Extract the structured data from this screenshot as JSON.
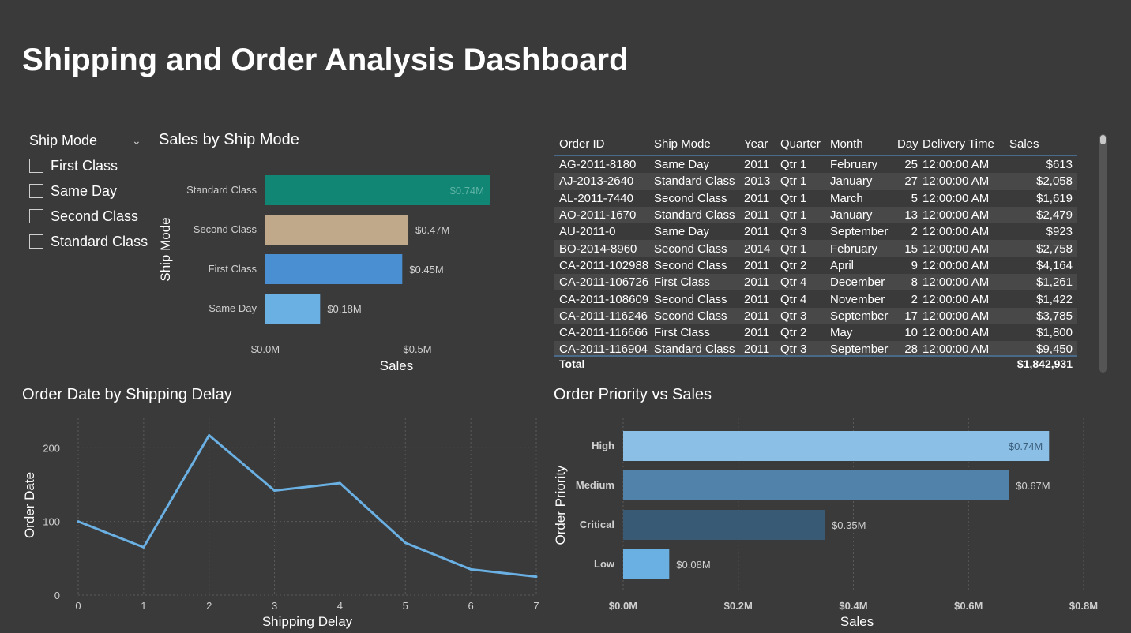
{
  "page": {
    "title": "Shipping and Order Analysis Dashboard"
  },
  "slicer": {
    "title": "Ship Mode",
    "items": [
      {
        "label": "First Class",
        "checked": false
      },
      {
        "label": "Same Day",
        "checked": false
      },
      {
        "label": "Second Class",
        "checked": false
      },
      {
        "label": "Standard Class",
        "checked": false
      }
    ]
  },
  "colors": {
    "background": "#3a3a3a",
    "line": "#6ab0e3",
    "text": "#ffffff"
  },
  "icons": {
    "slicer_dropdown": "chevron-down-icon"
  },
  "chart_data": [
    {
      "id": "sales_by_ship_mode",
      "type": "bar",
      "orientation": "horizontal",
      "title": "Sales by Ship Mode",
      "xlabel": "Sales",
      "ylabel": "Ship Mode",
      "categories": [
        "Standard Class",
        "Second Class",
        "First Class",
        "Same Day"
      ],
      "values": [
        0.74,
        0.47,
        0.45,
        0.18
      ],
      "data_labels": [
        "$0.74M",
        "$0.47M",
        "$0.45M",
        "$0.18M"
      ],
      "colors": [
        "#118675",
        "#c0a88a",
        "#4a8fd1",
        "#6ab0e3"
      ],
      "xlim": [
        0,
        0.74
      ],
      "xticks": [
        0,
        0.5
      ],
      "xtick_labels": [
        "$0.0M",
        "$0.5M"
      ],
      "grid": false
    },
    {
      "id": "order_date_by_shipping_delay",
      "type": "line",
      "title": "Order Date by Shipping Delay",
      "xlabel": "Shipping Delay",
      "ylabel": "Order Date",
      "x": [
        0,
        1,
        2,
        3,
        4,
        5,
        6,
        7
      ],
      "series": [
        {
          "values": [
            100,
            65,
            217,
            142,
            152,
            71,
            35,
            25
          ]
        }
      ],
      "xlim": [
        0,
        7
      ],
      "ylim": [
        0,
        240
      ],
      "xticks": [
        0,
        1,
        2,
        3,
        4,
        5,
        6,
        7
      ],
      "yticks": [
        0,
        100,
        200
      ],
      "grid": true
    },
    {
      "id": "order_priority_vs_sales",
      "type": "bar",
      "orientation": "horizontal",
      "title": "Order Priority vs Sales",
      "xlabel": "Sales",
      "ylabel": "Order Priority",
      "categories": [
        "High",
        "Medium",
        "Critical",
        "Low"
      ],
      "values": [
        0.74,
        0.67,
        0.35,
        0.08
      ],
      "data_labels": [
        "$0.74M",
        "$0.67M",
        "$0.35M",
        "$0.08M"
      ],
      "colors": [
        "#8bbfe6",
        "#5182aa",
        "#395a74",
        "#6ab0e3"
      ],
      "xlim": [
        0,
        0.8
      ],
      "xticks": [
        0,
        0.2,
        0.4,
        0.6,
        0.8
      ],
      "xtick_labels": [
        "$0.0M",
        "$0.2M",
        "$0.4M",
        "$0.6M",
        "$0.8M"
      ],
      "grid": true
    }
  ],
  "table": {
    "columns": [
      "Order ID",
      "Ship Mode",
      "Year",
      "Quarter",
      "Month",
      "Day",
      "Delivery Time",
      "Sales"
    ],
    "rows": [
      [
        "AG-2011-8180",
        "Same Day",
        "2011",
        "Qtr 1",
        "February",
        "25",
        "12:00:00 AM",
        "$613"
      ],
      [
        "AJ-2013-2640",
        "Standard Class",
        "2013",
        "Qtr 1",
        "January",
        "27",
        "12:00:00 AM",
        "$2,058"
      ],
      [
        "AL-2011-7440",
        "Second Class",
        "2011",
        "Qtr 1",
        "March",
        "5",
        "12:00:00 AM",
        "$1,619"
      ],
      [
        "AO-2011-1670",
        "Standard Class",
        "2011",
        "Qtr 1",
        "January",
        "13",
        "12:00:00 AM",
        "$2,479"
      ],
      [
        "AU-2011-0",
        "Same Day",
        "2011",
        "Qtr 3",
        "September",
        "2",
        "12:00:00 AM",
        "$923"
      ],
      [
        "BO-2014-8960",
        "Second Class",
        "2014",
        "Qtr 1",
        "February",
        "15",
        "12:00:00 AM",
        "$2,758"
      ],
      [
        "CA-2011-102988",
        "Second Class",
        "2011",
        "Qtr 2",
        "April",
        "9",
        "12:00:00 AM",
        "$4,164"
      ],
      [
        "CA-2011-106726",
        "First Class",
        "2011",
        "Qtr 4",
        "December",
        "8",
        "12:00:00 AM",
        "$1,261"
      ],
      [
        "CA-2011-108609",
        "Second Class",
        "2011",
        "Qtr 4",
        "November",
        "2",
        "12:00:00 AM",
        "$1,422"
      ],
      [
        "CA-2011-116246",
        "Second Class",
        "2011",
        "Qtr 3",
        "September",
        "17",
        "12:00:00 AM",
        "$3,785"
      ],
      [
        "CA-2011-116666",
        "First Class",
        "2011",
        "Qtr 2",
        "May",
        "10",
        "12:00:00 AM",
        "$1,800"
      ],
      [
        "CA-2011-116904",
        "Standard Class",
        "2011",
        "Qtr 3",
        "September",
        "28",
        "12:00:00 AM",
        "$9,450"
      ]
    ],
    "total_label": "Total",
    "total_value": "$1,842,931"
  }
}
